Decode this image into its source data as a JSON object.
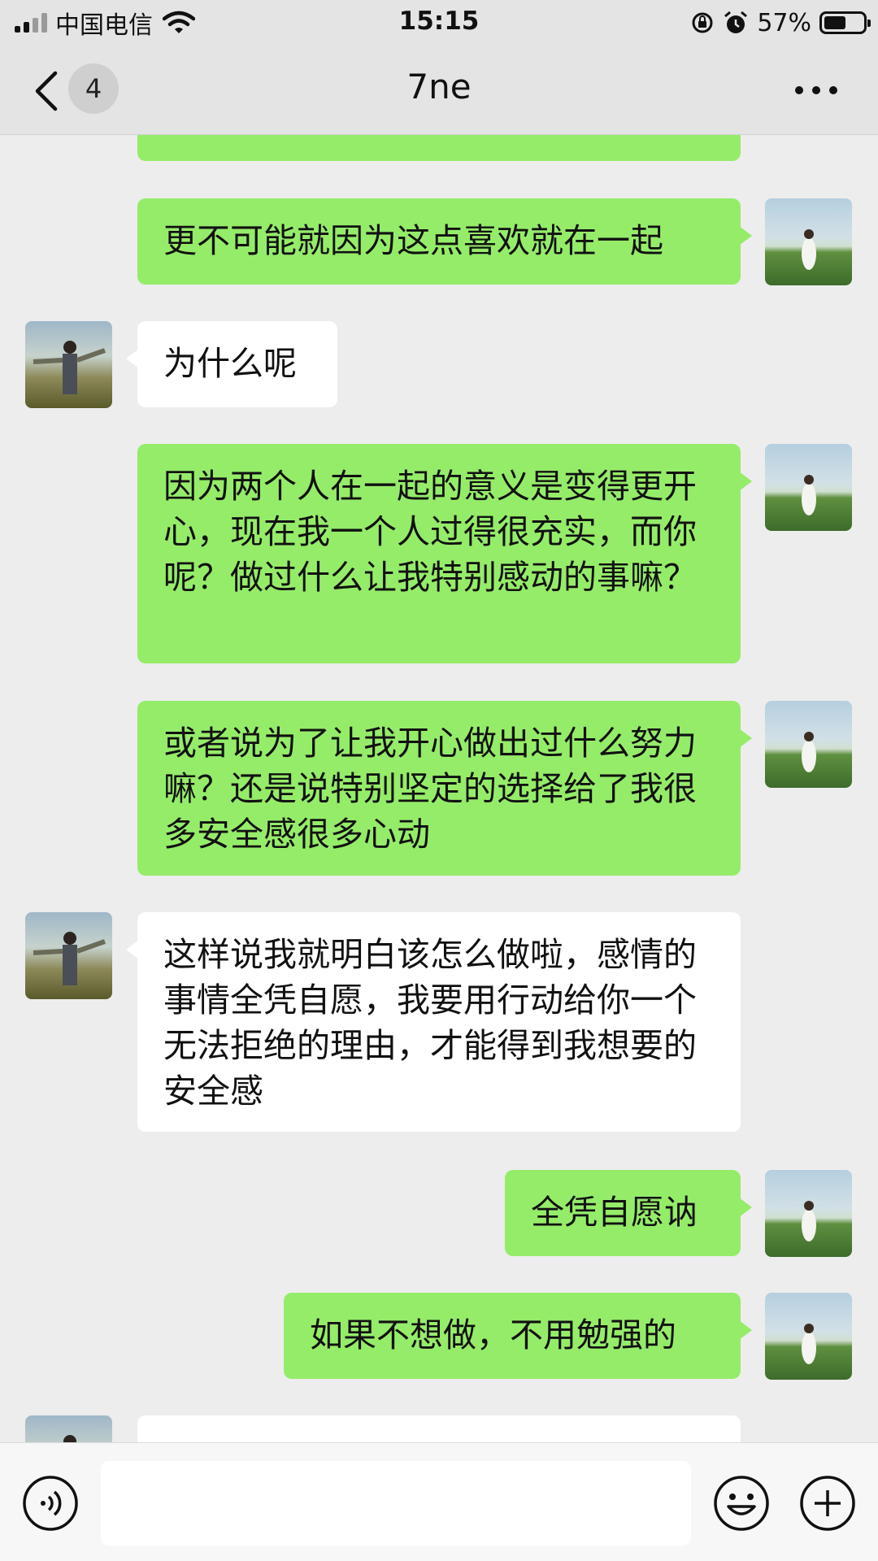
{
  "status_bar": {
    "carrier": "中国电信",
    "time": "15:15",
    "battery_percent": "57%",
    "battery_level": 0.57
  },
  "header": {
    "back_icon": "chevron-left-icon",
    "unread_count": "4",
    "title": "7ne",
    "more_icon": "ellipsis-icon"
  },
  "messages": [
    {
      "side": "out",
      "text": ""
    },
    {
      "side": "out",
      "text": "更不可能就因为这点喜欢就在一起"
    },
    {
      "side": "in",
      "text": "为什么呢"
    },
    {
      "side": "out",
      "text": "因为两个人在一起的意义是变得更开心，现在我一个人过得很充实，而你呢？做过什么让我特别感动的事嘛？"
    },
    {
      "side": "out",
      "text": "或者说为了让我开心做出过什么努力嘛？还是说特别坚定的选择给了我很多安全感很多心动"
    },
    {
      "side": "in",
      "text": "这样说我就明白该怎么做啦，感情的事情全凭自愿，我要用行动给你一个无法拒绝的理由，才能得到我想要的安全感"
    },
    {
      "side": "out",
      "text": "全凭自愿讷"
    },
    {
      "side": "out",
      "text": "如果不想做，不用勉强的"
    },
    {
      "side": "in",
      "text": ""
    }
  ],
  "input_bar": {
    "voice_icon": "voice-icon",
    "emoji_icon": "emoji-icon",
    "plus_icon": "plus-icon",
    "placeholder": ""
  },
  "colors": {
    "outgoing_bubble": "#95ec69",
    "incoming_bubble": "#ffffff",
    "background": "#ededed"
  }
}
